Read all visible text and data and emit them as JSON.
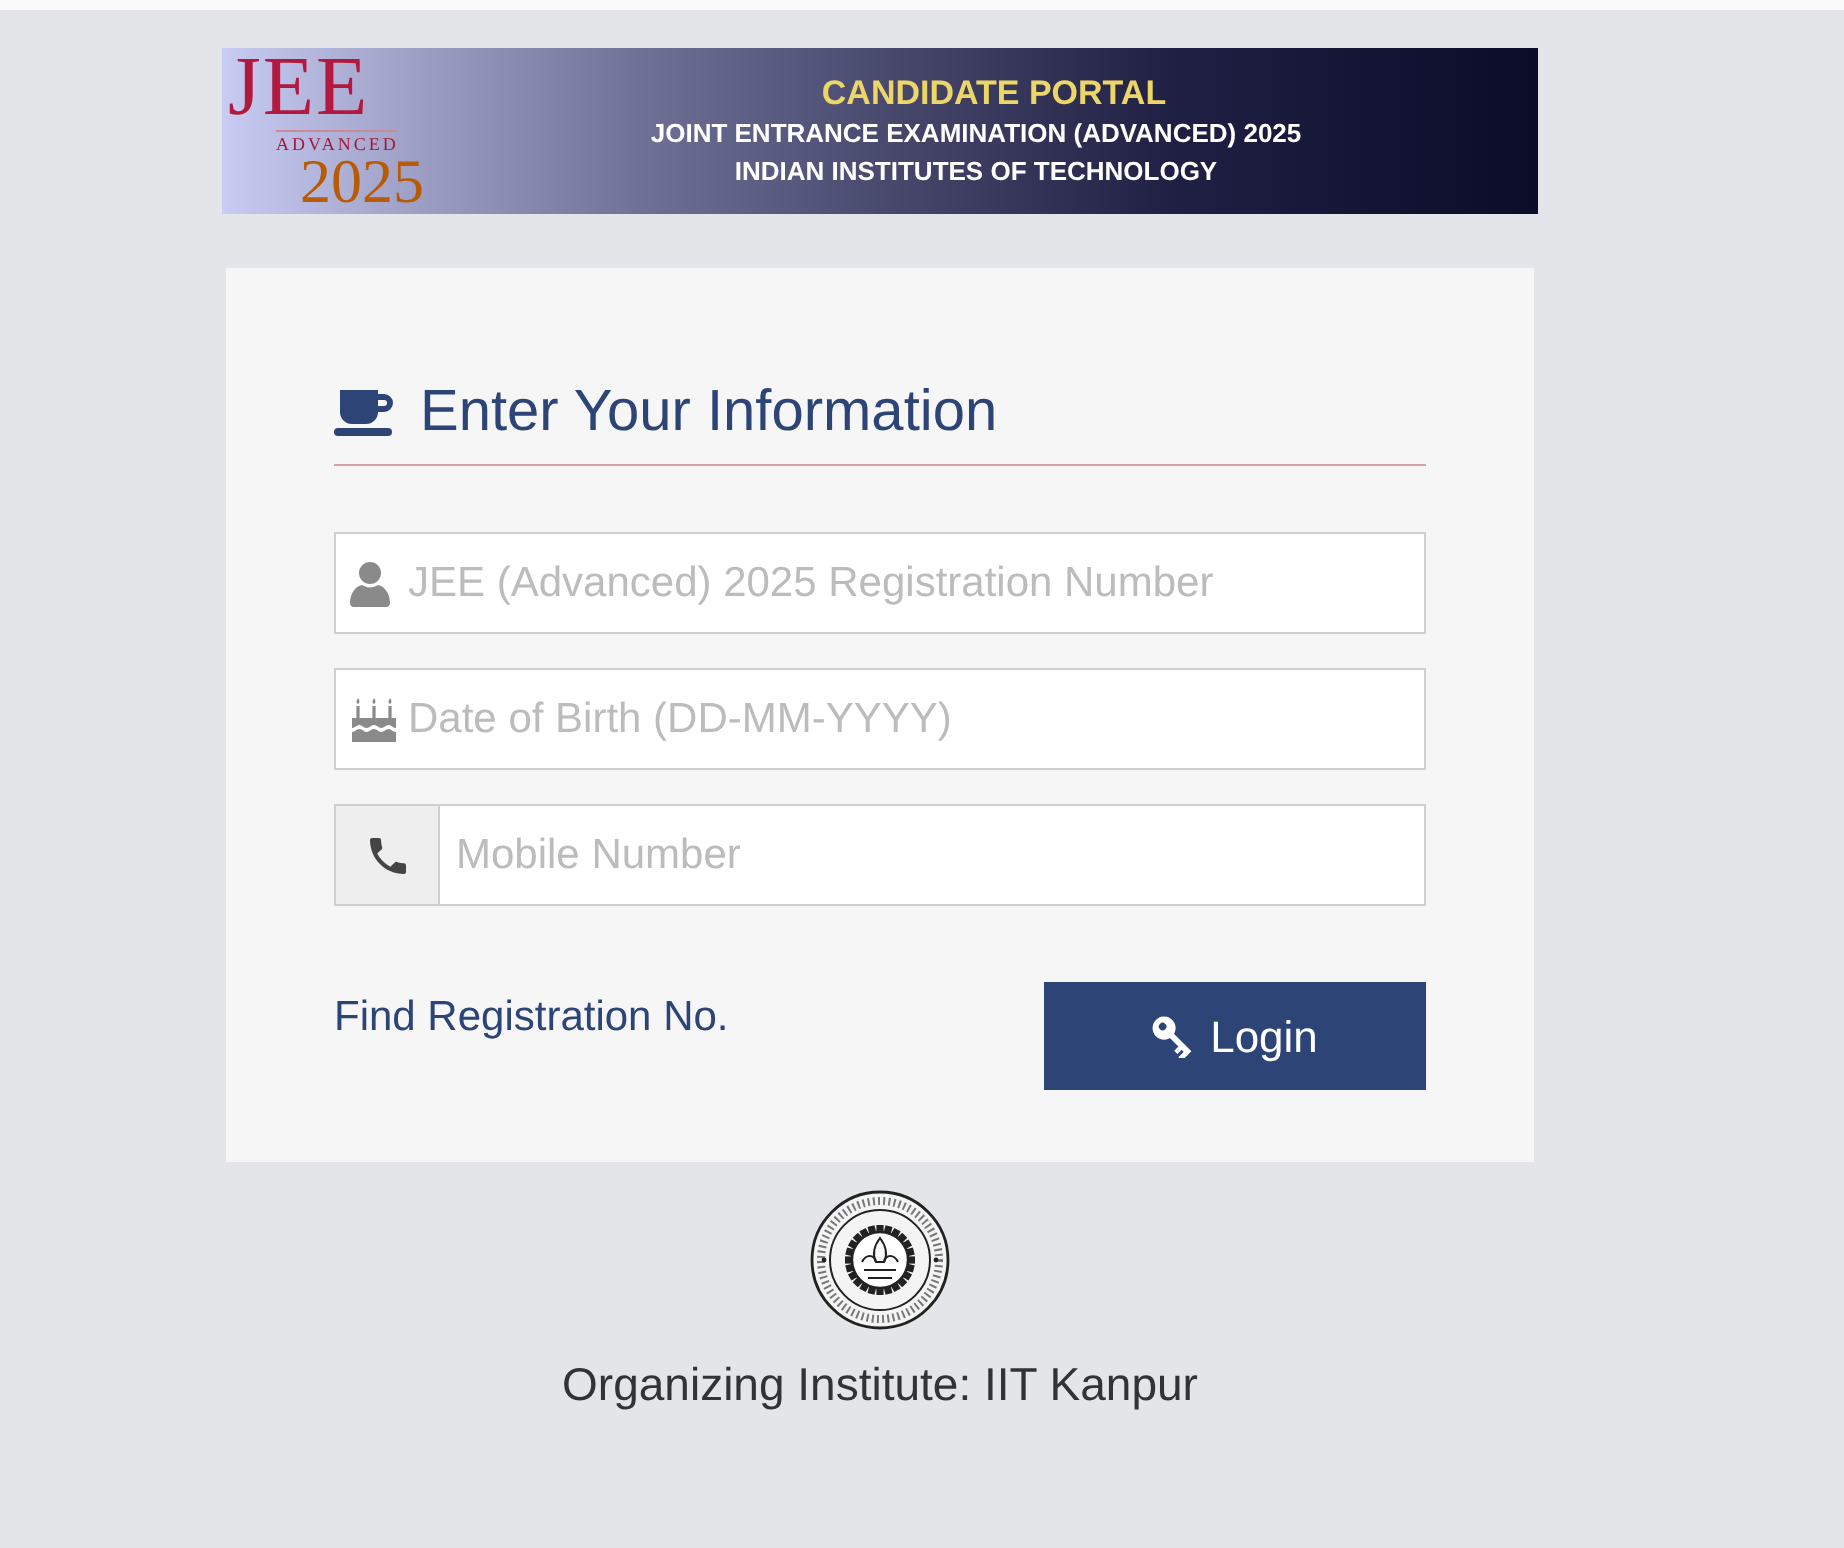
{
  "banner": {
    "logo": {
      "wordmark": "JEE",
      "tagline": "ADVANCED",
      "year": "2025"
    },
    "title": "CANDIDATE PORTAL",
    "lines": [
      "JOINT ENTRANCE EXAMINATION (ADVANCED) 2025",
      "INDIAN INSTITUTES OF TECHNOLOGY"
    ]
  },
  "form": {
    "heading": "Enter Your Information",
    "fields": [
      {
        "kind": "inline",
        "placeholder": "JEE (Advanced) 2025 Registration Number"
      },
      {
        "kind": "inline",
        "placeholder": "Date of Birth (DD-MM-YYYY)"
      },
      {
        "kind": "addon",
        "placeholder": "Mobile Number"
      }
    ],
    "find_link": "Find Registration No.",
    "login_button": "Login"
  },
  "footer": {
    "caption": "Organizing Institute: IIT Kanpur"
  }
}
